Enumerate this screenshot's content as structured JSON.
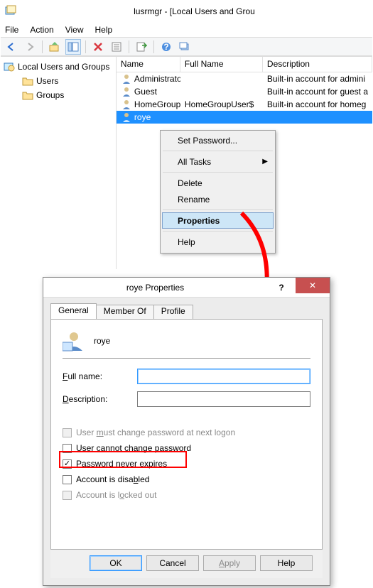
{
  "mmc": {
    "title": "lusrmgr - [Local Users and Grou",
    "menus": {
      "file": "File",
      "action": "Action",
      "view": "View",
      "help": "Help"
    },
    "tree": {
      "root": "Local Users and Groups",
      "users": "Users",
      "groups": "Groups"
    },
    "columns": {
      "name": "Name",
      "fullname": "Full Name",
      "description": "Description"
    },
    "rows": [
      {
        "name": "Administrator",
        "full": "",
        "desc": "Built-in account for admini"
      },
      {
        "name": "Guest",
        "full": "",
        "desc": "Built-in account for guest a"
      },
      {
        "name": "HomeGroup...",
        "full": "HomeGroupUser$",
        "desc": "Built-in account for homeg"
      },
      {
        "name": "roye",
        "full": "",
        "desc": ""
      }
    ]
  },
  "ctx": {
    "setpw": "Set Password...",
    "alltasks": "All Tasks",
    "delete": "Delete",
    "rename": "Rename",
    "properties": "Properties",
    "help": "Help"
  },
  "props": {
    "title": "roye Properties",
    "tabs": {
      "general": "General",
      "memberof": "Member Of",
      "profile": "Profile"
    },
    "username": "roye",
    "labels": {
      "fullname_u": "F",
      "fullname_rest": "ull name:",
      "description_u": "D",
      "description_rest": "escription:",
      "mustchange_1": "User ",
      "mustchange_u": "m",
      "mustchange_2": "ust change password at next logon",
      "cannot_1": "User ",
      "cannot_u": "c",
      "cannot_2": "annot change password",
      "never_u": "P",
      "never_rest": "assword never expires",
      "disabled_1": "Account is disa",
      "disabled_u": "b",
      "disabled_2": "led",
      "locked_1": "Account is l",
      "locked_u": "o",
      "locked_2": "cked out"
    },
    "fields": {
      "fullname": "",
      "description": ""
    },
    "buttons": {
      "ok": "OK",
      "cancel": "Cancel",
      "apply_u": "A",
      "apply_rest": "pply",
      "help": "Help",
      "help_q": "?",
      "close_x": "✕"
    },
    "checks": {
      "mustchange": false,
      "cannot": false,
      "never": true,
      "disabled": false,
      "locked": false
    }
  }
}
